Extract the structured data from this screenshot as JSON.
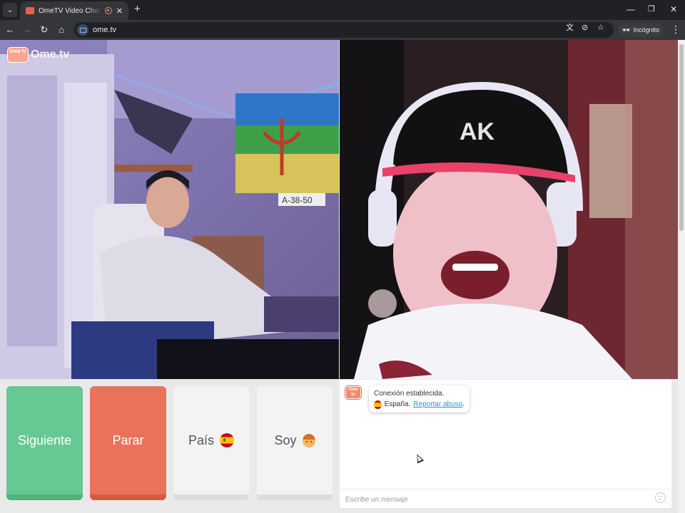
{
  "browser": {
    "tab_title": "OmeTV Video Chat — Omegle alternative",
    "url": "ome.tv",
    "incognito_label": "Incógnito",
    "new_tab_symbol": "+",
    "close_symbol": "✕"
  },
  "page": {
    "logo_text": "Ome.tv",
    "logo_badge": "Ome tv"
  },
  "controls": {
    "next_label": "Siguiente",
    "stop_label": "Parar",
    "country_label": "País",
    "gender_label": "Soy"
  },
  "chat": {
    "avatar_text": "Ome tv",
    "system_message": "Conexión establecida.",
    "country": "España.",
    "report_link": "Reportar abuso",
    "report_suffix": ".",
    "input_placeholder": "Escribe un mensaje"
  },
  "icons": [
    "tab-search-icon",
    "favicon-icon",
    "recording-icon",
    "close-icon",
    "new-tab-icon",
    "minimize-icon",
    "maximize-icon",
    "window-close-icon",
    "back-icon",
    "forward-icon",
    "reload-icon",
    "home-icon",
    "site-info-icon",
    "translate-icon",
    "eye-off-icon",
    "star-icon",
    "incognito-icon",
    "menu-icon",
    "spain-flag-icon",
    "face-icon",
    "emoji-icon",
    "cursor-icon"
  ],
  "colors": {
    "next": "#66c994",
    "stop": "#e9735a",
    "neutral_button": "#f3f3f3",
    "link": "#2f8fbf"
  }
}
